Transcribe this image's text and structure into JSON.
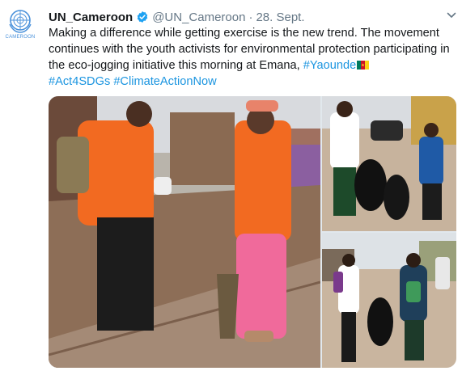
{
  "tweet": {
    "avatar_label": "CAMEROON",
    "display_name": "UN_Cameroon",
    "handle": "@UN_Cameroon",
    "separator": "·",
    "date": "28. Sept.",
    "text_main": "Making a difference while getting exercise is the new trend. The movement continues with the youth activists for environmental protection participating in the eco-jogging initiative this morning at Emana, ",
    "hashtag_city": "#Yaounde",
    "hashtag_1": "#Act4SDGs",
    "hashtag_2": "#ClimateActionNow"
  },
  "icons": {
    "avatar": "un-emblem-icon",
    "verified": "verified-badge-icon",
    "more": "chevron-down-icon",
    "flag": "cameroon-flag-icon"
  },
  "colors": {
    "link": "#1b95e0",
    "verified": "#1da1f2",
    "un_blue": "#4b92db",
    "secondary_text": "#657786"
  }
}
